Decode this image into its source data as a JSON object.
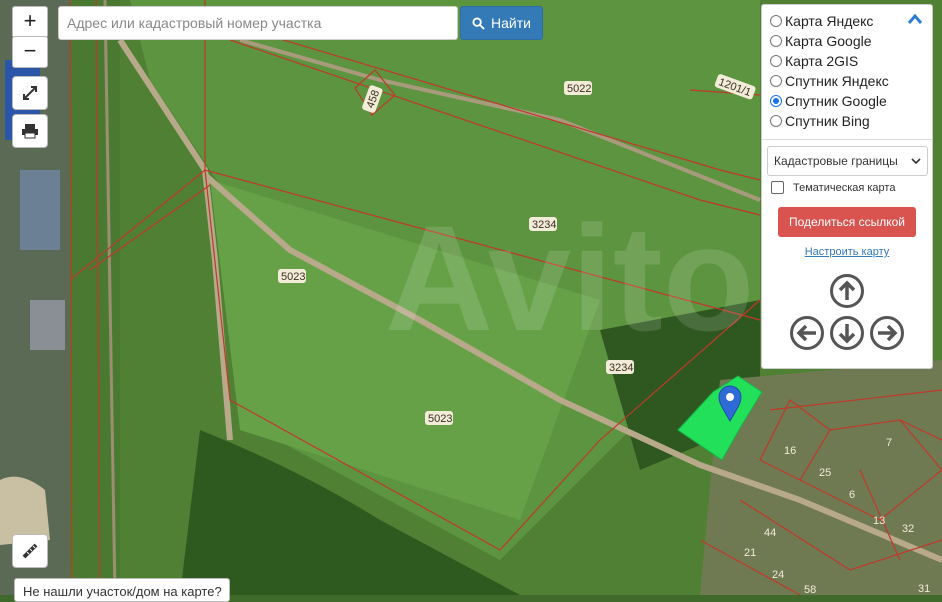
{
  "search": {
    "placeholder": "Адрес или кадастровый номер участка",
    "button_label": "Найти"
  },
  "zoom": {
    "in_label": "+",
    "out_label": "−"
  },
  "layers": [
    {
      "label": "Карта Яндекс",
      "selected": false
    },
    {
      "label": "Карта Google",
      "selected": false
    },
    {
      "label": "Карта 2GIS",
      "selected": false
    },
    {
      "label": "Спутник Яндекс",
      "selected": false
    },
    {
      "label": "Спутник Google",
      "selected": true
    },
    {
      "label": "Спутник Bing",
      "selected": false
    }
  ],
  "boundary_select": {
    "value": "Кадастровые границы"
  },
  "thematic": {
    "label": "Тематическая карта",
    "checked": false
  },
  "share_button": "Поделиться ссылкой",
  "setup_link": "Настроить карту",
  "not_found": "Не нашли участок/дом на карте?",
  "parcel_labels": {
    "p5022": "5022",
    "p458": "458",
    "p1201": "1201/1",
    "p3234a": "3234",
    "p5023a": "5023",
    "p3234b": "3234",
    "p5023b": "5023",
    "h16": "16",
    "h25": "25",
    "h6": "6",
    "h13": "13",
    "h7": "7",
    "h32": "32",
    "h44": "44",
    "h21": "21",
    "h24": "24",
    "h58": "58",
    "h31": "31"
  },
  "watermark": "Avito",
  "colors": {
    "accent": "#337ab7",
    "share": "#d9534f",
    "parcel_highlight": "#22e05a",
    "boundary": "#c0392b",
    "marker": "#2f6bd6"
  }
}
